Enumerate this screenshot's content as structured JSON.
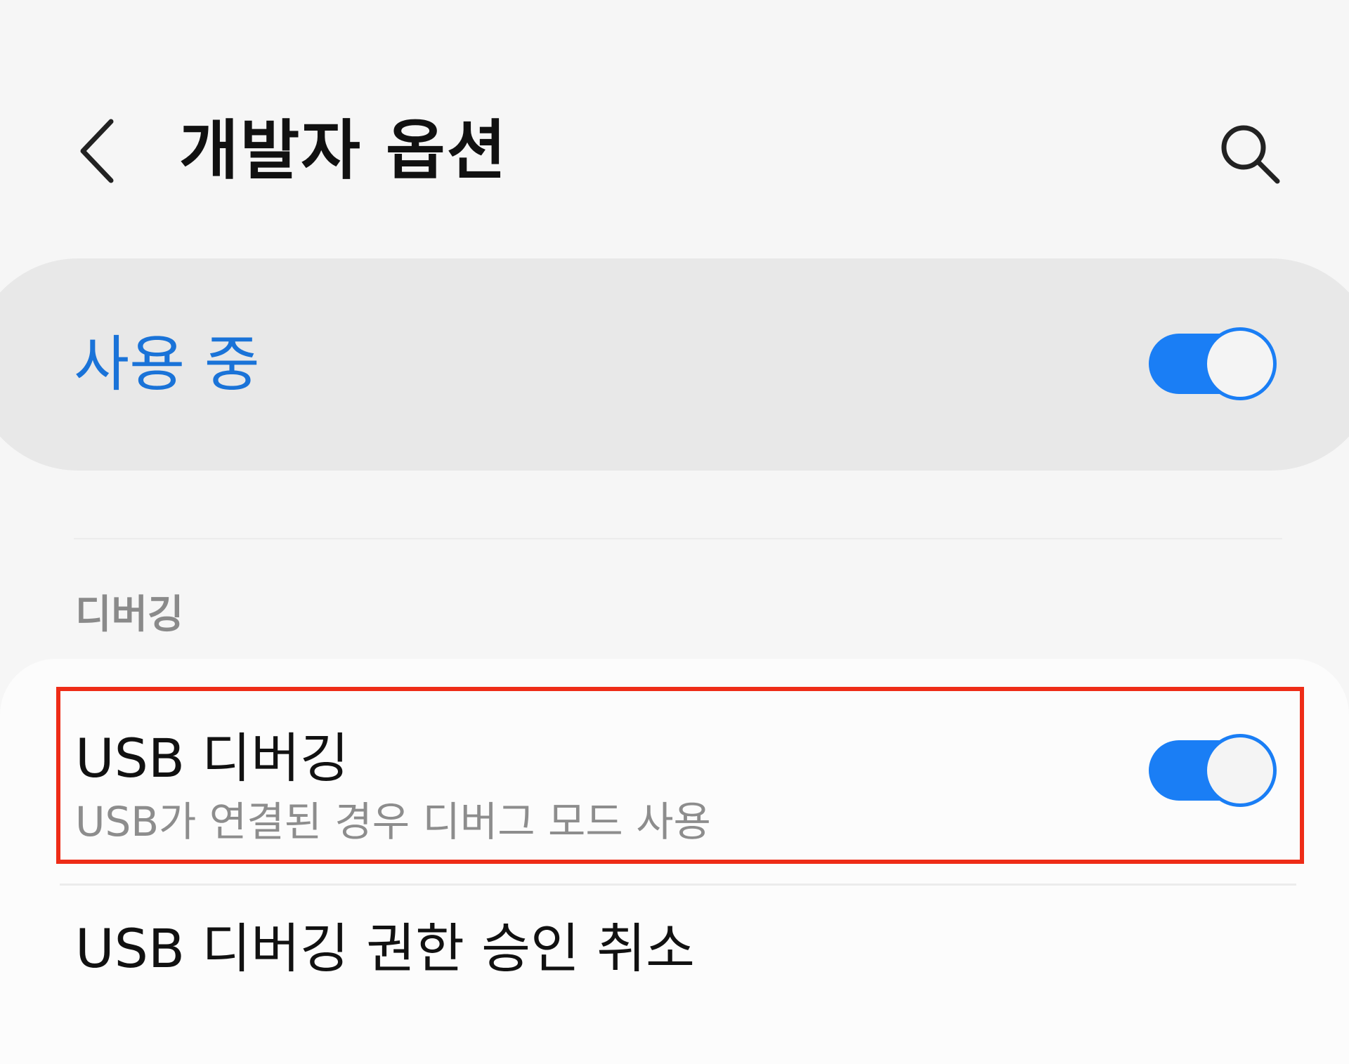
{
  "header": {
    "title": "개발자 옵션",
    "back_icon": "chevron-left-icon",
    "search_icon": "search-icon"
  },
  "master_switch": {
    "label": "사용 중",
    "state": "on",
    "accent_color": "#1a7ef5",
    "label_color": "#1a73d8"
  },
  "debug_section": {
    "header": "디버깅",
    "items": [
      {
        "title": "USB 디버깅",
        "subtitle": "USB가 연결된 경우 디버그 모드 사용",
        "toggle": "on",
        "highlighted": true,
        "highlight_color": "#ee2c17"
      },
      {
        "title": "USB 디버깅 권한 승인 취소"
      }
    ]
  }
}
